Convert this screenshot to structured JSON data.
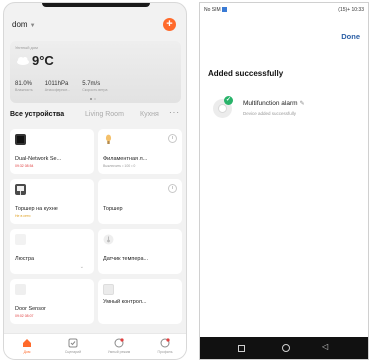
{
  "left_screen": {
    "home_selector": "dom",
    "add_button_label": "+",
    "weather": {
      "location": "Уютный дом",
      "temperature": "9°C",
      "stats": [
        {
          "value": "81.0%",
          "label": "Влажность"
        },
        {
          "value": "1011hPa",
          "label": "Атмосферное..."
        },
        {
          "value": "5.7m/s",
          "label": "Скорость ветра"
        }
      ]
    },
    "tabs": [
      "Все устройства",
      "Living Room",
      "Кухня"
    ],
    "tab_more": "···",
    "devices": [
      {
        "name": "Dual-Network Se...",
        "sub": "09:32 08:54"
      },
      {
        "name": "Филаментная л...",
        "sub": "Выключить • 100 • 0"
      },
      {
        "name": "Торшер на кухне",
        "sub": "Не в сети"
      },
      {
        "name": "Торшер",
        "sub": ""
      },
      {
        "name": "Люстра",
        "sub": ""
      },
      {
        "name": "Датчик темпера...",
        "sub": ""
      },
      {
        "name": "Door Sensor",
        "sub": "09:02 08:07"
      },
      {
        "name": "Умный контрол...",
        "sub": ""
      }
    ],
    "bottom_nav": [
      {
        "label": "Дом"
      },
      {
        "label": "Сценарий"
      },
      {
        "label": "Умный режим"
      },
      {
        "label": "Профиль"
      }
    ]
  },
  "right_screen": {
    "status_left": "No SIM",
    "status_right": "(15)+ 10:33",
    "done_label": "Done",
    "title": "Added successfully",
    "device_name": "Multifunction alarm",
    "device_status": "Device added successfully"
  },
  "colors": {
    "accent": "#ff6a2b",
    "link": "#2b5fa5",
    "success": "#29b36a"
  }
}
